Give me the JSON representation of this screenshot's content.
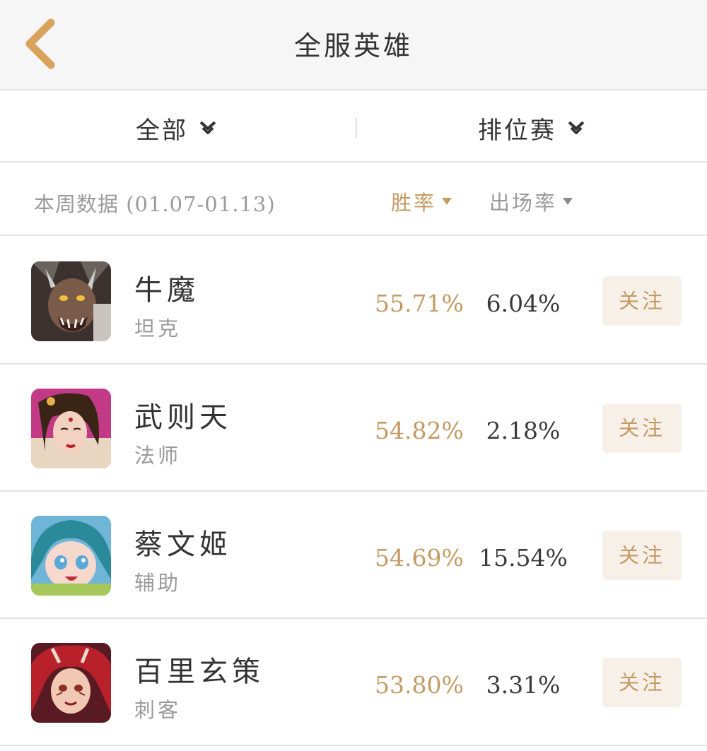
{
  "header": {
    "title": "全服英雄"
  },
  "filters": {
    "category": "全部",
    "mode": "排位赛"
  },
  "stats": {
    "week_label": "本周数据 (01.07-01.13)",
    "sort_win_label": "胜率",
    "sort_pick_label": "出场率"
  },
  "heroes": [
    {
      "name": "牛魔",
      "role": "坦克",
      "win_rate": "55.71%",
      "pick_rate": "6.04%",
      "follow_label": "关注"
    },
    {
      "name": "武则天",
      "role": "法师",
      "win_rate": "54.82%",
      "pick_rate": "2.18%",
      "follow_label": "关注"
    },
    {
      "name": "蔡文姬",
      "role": "辅助",
      "win_rate": "54.69%",
      "pick_rate": "15.54%",
      "follow_label": "关注"
    },
    {
      "name": "百里玄策",
      "role": "刺客",
      "win_rate": "53.80%",
      "pick_rate": "3.31%",
      "follow_label": "关注"
    }
  ],
  "colors": {
    "accent": "#c49a63",
    "follow_bg": "#f7f0e9",
    "header_bg": "#f6f6f6"
  },
  "icons": {
    "back": "chevron-left-icon",
    "filter": "double-chevron-down-icon",
    "sort": "triangle-down-icon"
  }
}
